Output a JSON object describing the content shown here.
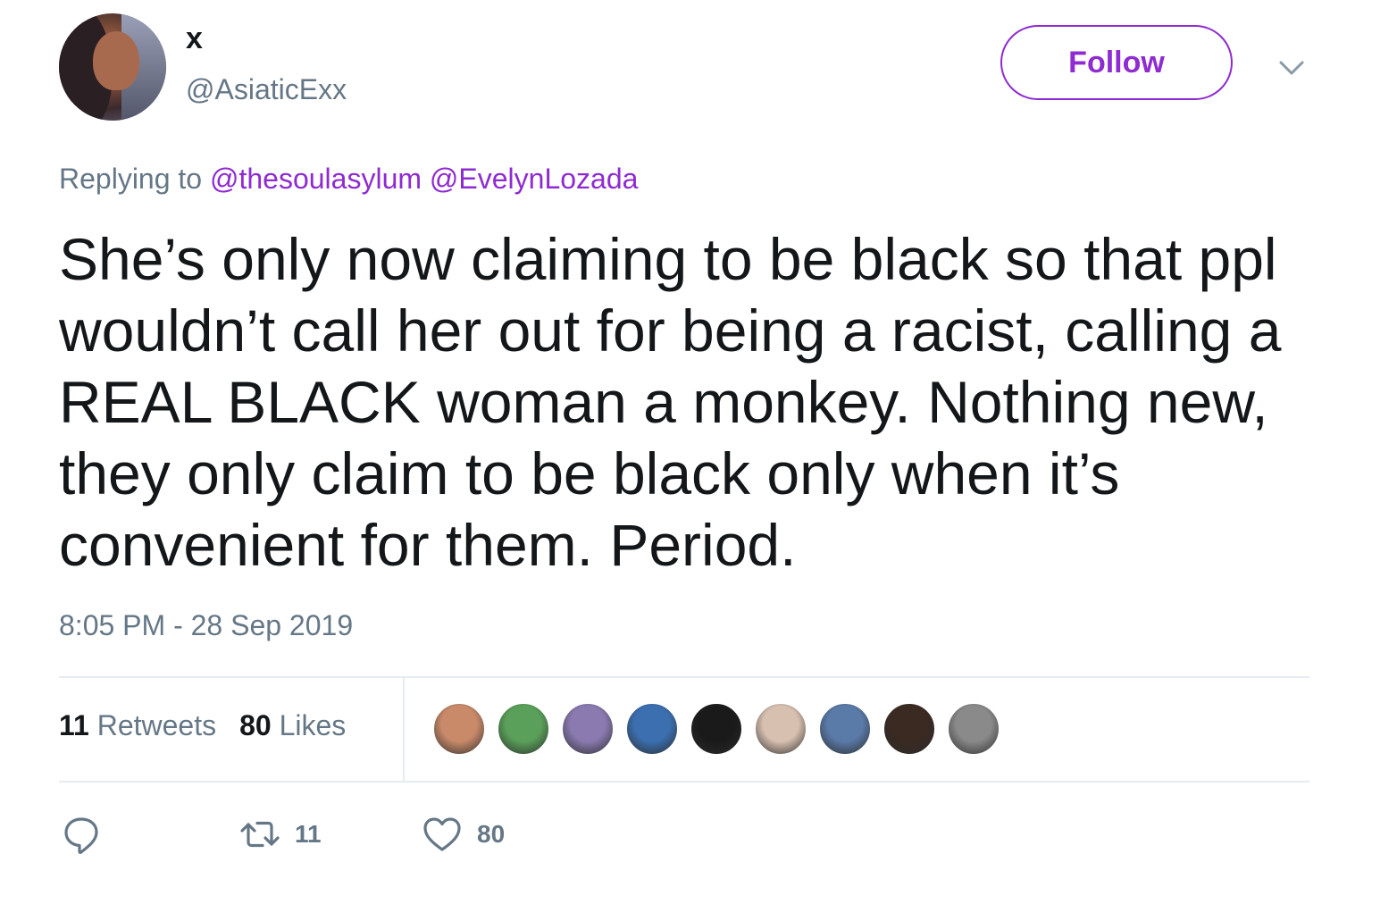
{
  "user": {
    "display_name": "x",
    "handle": "@AsiaticExx",
    "follow_label": "Follow"
  },
  "reply": {
    "prefix": "Replying to",
    "mentions": [
      "@thesoulasylum",
      "@EvelynLozada"
    ]
  },
  "tweet": {
    "text": "She’s only now claiming to be black so that ppl wouldn’t call her out for being a racist, calling a REAL BLACK woman a monkey. Nothing new, they only claim to be black only when it’s convenient for them. Period.",
    "timestamp": "8:05 PM - 28 Sep 2019"
  },
  "stats": {
    "retweets_count": "11",
    "retweets_label": "Retweets",
    "likes_count": "80",
    "likes_label": "Likes"
  },
  "likers": [
    {
      "icon": "liker-avatar-1",
      "color": "#c98a6a"
    },
    {
      "icon": "liker-avatar-2",
      "color": "#5aa05a"
    },
    {
      "icon": "liker-avatar-3",
      "color": "#8a7ab0"
    },
    {
      "icon": "liker-avatar-4",
      "color": "#3b6fb0"
    },
    {
      "icon": "liker-avatar-5",
      "color": "#1a1a1a"
    },
    {
      "icon": "liker-avatar-6",
      "color": "#d8c0b0"
    },
    {
      "icon": "liker-avatar-7",
      "color": "#5a7aa8"
    },
    {
      "icon": "liker-avatar-8",
      "color": "#3a2a22"
    },
    {
      "icon": "liker-avatar-9",
      "color": "#8a8a8a"
    }
  ],
  "actions": {
    "reply_icon": "reply-icon",
    "retweet_count": "11",
    "like_count": "80"
  },
  "colors": {
    "accent": "#8e2bd1",
    "secondary_text": "#657786",
    "primary_text": "#14171a",
    "divider": "#e6ecf0"
  }
}
